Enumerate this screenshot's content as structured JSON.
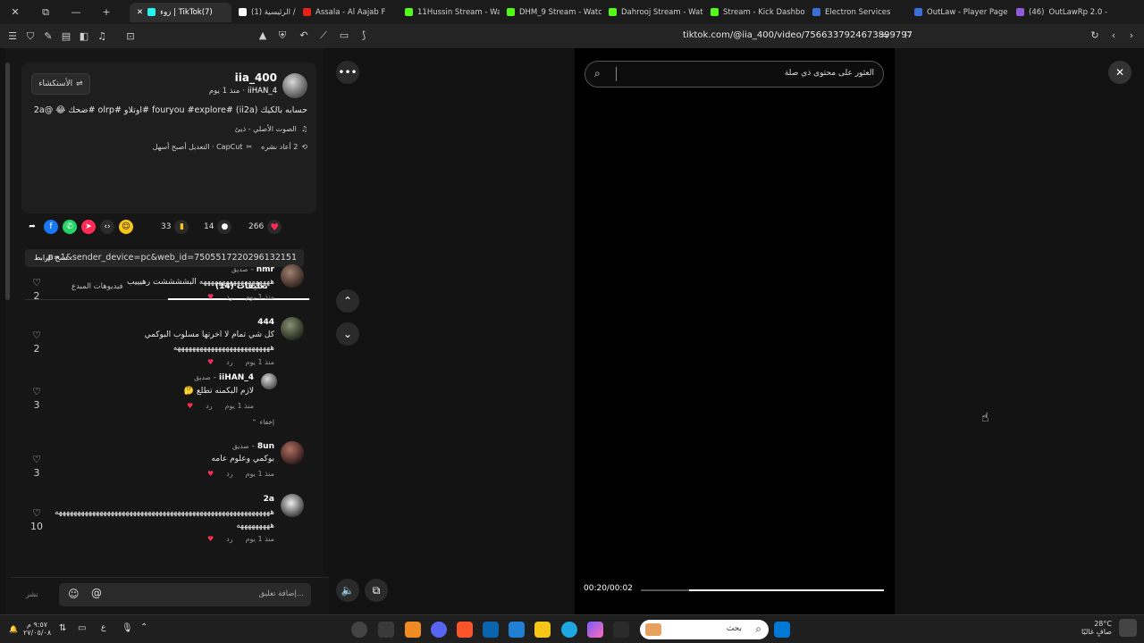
{
  "browser": {
    "tabs": [
      {
        "label": "OutLawRp 2.0 - Live",
        "color": "#8f5bd6",
        "badge": "(46)"
      },
      {
        "label": "OutLaw - Player Page",
        "color": "#3a6fd8"
      },
      {
        "label": "Electron Services",
        "color": "#3a6fd8"
      },
      {
        "label": "Stream - Kick Dashboa",
        "color": "#53fc18"
      },
      {
        "label": "Dahrooj Stream - Watc",
        "color": "#53fc18"
      },
      {
        "label": "DHM_9 Stream - Watc",
        "color": "#53fc18"
      },
      {
        "label": "11Hussin Stream - Wat",
        "color": "#53fc18"
      },
      {
        "label": "Assala - Al Aajab F",
        "color": "#e62117"
      },
      {
        "label": "(1) الرئيسية / X",
        "color": "#ffffff"
      },
      {
        "label": "زوء | TikTok(7)",
        "color": "#25f4ee",
        "active": true
      }
    ],
    "url": "tiktok.com/@iia_400/video/7566337924673899797"
  },
  "post": {
    "username": "iia_400",
    "handle": "iiHAN_4",
    "time": "منذ 1 يوم",
    "follow_label": "الأستكشاء",
    "caption": "حسابه بالكيك (ii2a) #fouryou #explore #اوتلاو #olrp #ضحك 😂 @2a",
    "sound": "الصوت الأصلي - ذيئ",
    "reposts": "2 أعاد نشره",
    "capcut": "CapCut · التعديل أصبح أسهل"
  },
  "actions": {
    "likes": "266",
    "comments": "14",
    "saves": "33"
  },
  "share": {
    "link": "...p=1&sender_device=pc&web_id=7505517220296132151",
    "copy_label": "نسخ الرابط"
  },
  "tabs": {
    "comments": "تعليقات (14)",
    "creator_videos": "فيديوهات المبدع"
  },
  "comments": [
    {
      "user": "nmr",
      "tag": "صديق",
      "text": "هههههههههههههههههههه البششششت رهيييب",
      "time": "منذ 1 يوم",
      "reply": "رد",
      "likes": "2"
    },
    {
      "user": "444",
      "tag": "",
      "text": "كل شي تمام لا اخرتها مسلوب البوكمي",
      "text2": "ههههههههههههههههههههههههههه",
      "time": "منذ 1 يوم",
      "reply": "رد",
      "likes": "2"
    },
    {
      "user": "iiHAN_4",
      "tag": "صديق",
      "text": "لازم البكمنه تطلع 🤔",
      "time": "منذ 1 يوم",
      "reply": "رد",
      "likes": "3",
      "hide": "إخفاء"
    },
    {
      "user": "8un",
      "tag": "صديق",
      "text": "بوكمي وعلوم عامه",
      "time": "منذ 1 يوم",
      "reply": "رد",
      "likes": "3"
    },
    {
      "user": "2a",
      "tag": "",
      "text": "ههههههههههههههههههههههههههههههههههههههههههههههههههههههههههه",
      "text2": "هههههههههه",
      "time": "منذ 1 يوم",
      "reply": "رد",
      "likes": "10"
    }
  ],
  "composer": {
    "placeholder": "إضافة تعليق...",
    "post_label": "نشر"
  },
  "video": {
    "search_placeholder": "العثور على محتوى ذي صلة",
    "time": "00:20/00:02",
    "progress": 0.8
  },
  "taskbar": {
    "search_label": "بحث",
    "weather_temp": "28°C",
    "weather_desc": "صافٍ غالبًا",
    "clock_time": "٩:٥٧ م",
    "clock_date": "٢٧/٠٥/٠٨",
    "lang": "ع"
  }
}
